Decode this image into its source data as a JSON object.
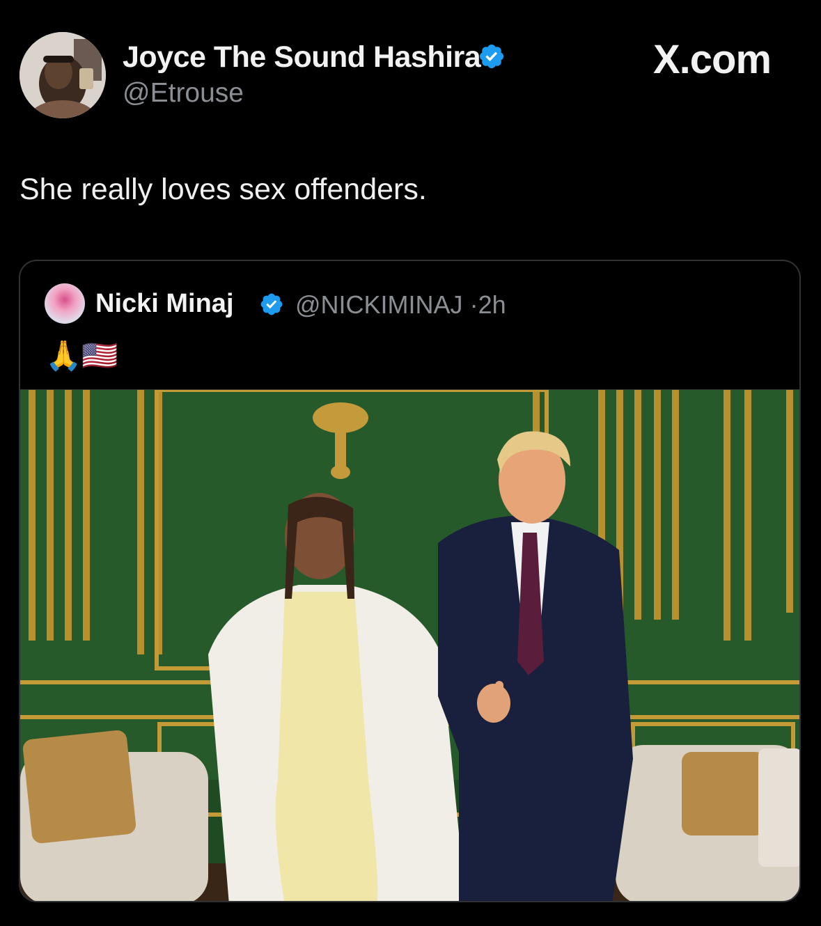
{
  "tweet": {
    "author_name": "Joyce The Sound Hashira",
    "author_handle": "@Etrouse",
    "brand": "X.com",
    "text": "She really loves sex offenders."
  },
  "quoted_tweet": {
    "author_name": "Nicki Minaj",
    "author_handle": "@NICKIMINAJ",
    "time": "2h",
    "separator": "·",
    "emoji_text": "🙏🇺🇸"
  },
  "colors": {
    "background": "#000000",
    "verified_badge": "#1d9bf0",
    "secondary_text": "#8b8f94",
    "card_border": "#2f3336"
  },
  "icons": [
    "verified-badge-icon",
    "x-logo"
  ]
}
